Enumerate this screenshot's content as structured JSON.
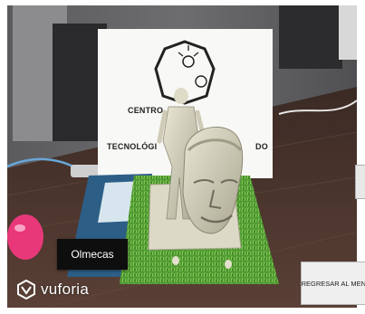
{
  "scene": {
    "card_title_line1": "CENTRO",
    "card_title_line2": "TECNOLÓGI",
    "card_title_line2_tail": "DO",
    "marker_label": "Olmecas"
  },
  "overlay": {
    "brand": "vuforia",
    "brand_logo_icon": "vuforia-logo-icon",
    "back_button_label": "REGRESAR AL MENU"
  },
  "colors": {
    "grass": "#4f9a33",
    "overlay_button_bg": "#efefef",
    "marker_label_bg": "#0e0e0e"
  }
}
